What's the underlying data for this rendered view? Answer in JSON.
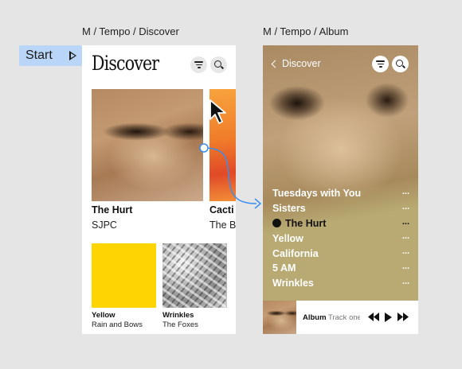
{
  "frames": {
    "discover_label": "M / Tempo / Discover",
    "album_label": "M / Tempo / Album"
  },
  "start": {
    "label": "Start"
  },
  "discover": {
    "title": "Discover",
    "featured": [
      {
        "title": "The Hurt",
        "artist": "SJPC"
      },
      {
        "title": "Cacti",
        "artist": "The B"
      }
    ],
    "grid": [
      {
        "title": "Yellow",
        "artist": "Rain and Bows"
      },
      {
        "title": "Wrinkles",
        "artist": "The Foxes"
      }
    ]
  },
  "album": {
    "back_label": "Discover",
    "tracks": [
      {
        "title": "Tuesdays with You",
        "more": "..."
      },
      {
        "title": "Sisters",
        "more": "..."
      },
      {
        "title": "The Hurt",
        "more": "..."
      },
      {
        "title": "Yellow",
        "more": "..."
      },
      {
        "title": "California",
        "more": "..."
      },
      {
        "title": "5 AM",
        "more": "..."
      },
      {
        "title": "Wrinkles",
        "more": "..."
      }
    ],
    "current_track_index": 2,
    "player": {
      "album_label": "Album",
      "track_text": "Track one"
    }
  },
  "icons": [
    "filter-icon",
    "search-icon",
    "play-icon",
    "chevron-left-icon",
    "more-icon",
    "rewind-icon",
    "fast-forward-icon",
    "cursor-icon"
  ],
  "colors": {
    "start_chip": "#b9d6f8",
    "connector": "#3a8ef0",
    "yellow_cover": "#ffd500",
    "album_bg": "#b8aa72"
  }
}
